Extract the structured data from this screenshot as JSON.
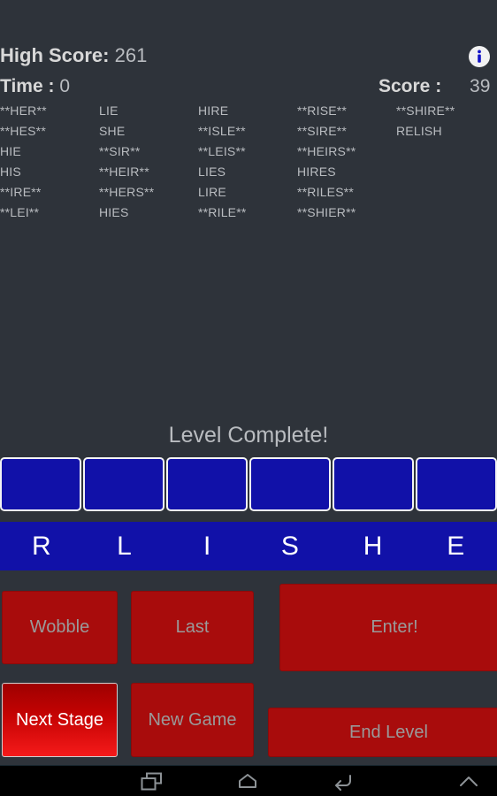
{
  "header": {
    "high_score_label": "High Score:",
    "high_score_value": "261",
    "time_label": "Time :",
    "time_value": "0",
    "score_label": "Score :",
    "score_value": "39",
    "info_icon": "info-icon"
  },
  "word_list": {
    "columns": [
      [
        "**HER**",
        "**HES**",
        "HIE",
        "HIS",
        "**IRE**",
        "**LEI**"
      ],
      [
        "LIE",
        "SHE",
        "**SIR**",
        "**HEIR**",
        "**HERS**",
        "HIES"
      ],
      [
        "HIRE",
        "**ISLE**",
        "**LEIS**",
        "LIES",
        "LIRE",
        "**RILE**"
      ],
      [
        "**RISE**",
        "**SIRE**",
        "**HEIRS**",
        "HIRES",
        "**RILES**",
        "**SHIER**"
      ],
      [
        "**SHIRE**",
        "RELISH"
      ]
    ]
  },
  "status": {
    "message": "Level Complete!"
  },
  "answer_tiles": [
    "",
    "",
    "",
    "",
    "",
    ""
  ],
  "letter_rack": [
    "R",
    "L",
    "I",
    "S",
    "H",
    "E"
  ],
  "buttons": {
    "wobble": "Wobble",
    "last": "Last",
    "enter": "Enter!",
    "next_stage": "Next Stage",
    "new_game": "New Game",
    "end_level": "End Level"
  },
  "navbar": {
    "recents": "recents-icon",
    "home": "home-icon",
    "back": "back-icon",
    "expand": "chevron-up-icon"
  },
  "colors": {
    "background": "#2e333a",
    "tile_blue": "#1111a8",
    "button_red": "#a80c0c",
    "highlight_red": "#f51a1a",
    "text_grey": "#b9bcc0"
  }
}
